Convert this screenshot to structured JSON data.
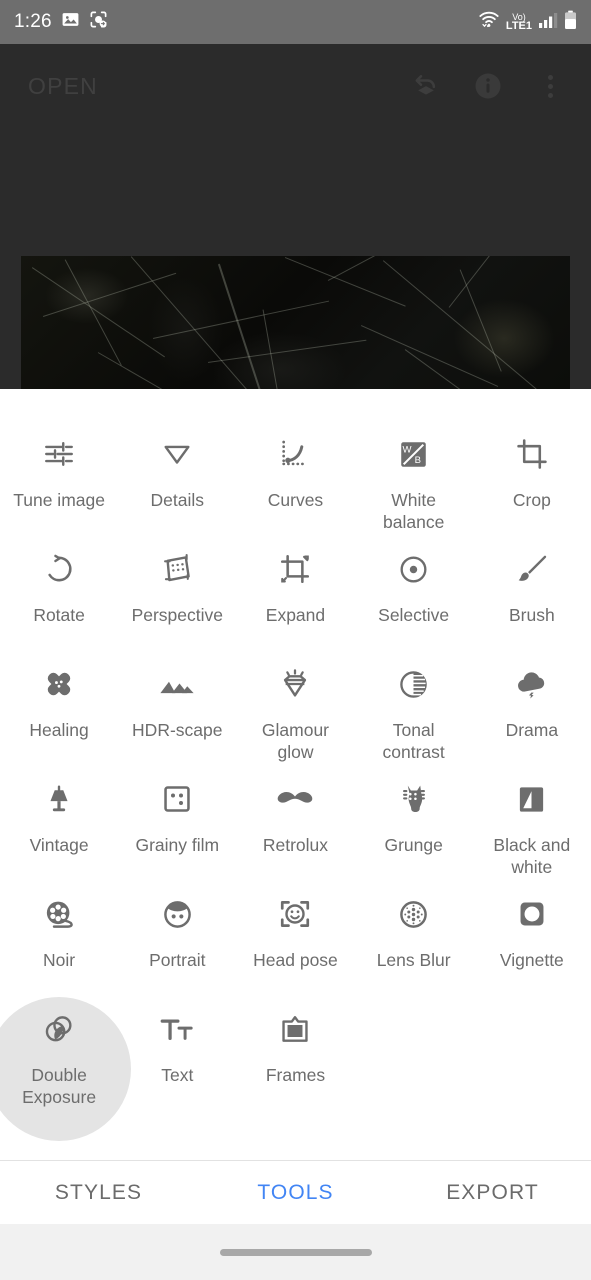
{
  "status_bar": {
    "time": "1:26",
    "left_icons": [
      "image-icon",
      "screenshot-capture-icon"
    ],
    "right_icons": [
      "wifi-icon",
      "volte-icon",
      "signal-icon",
      "battery-icon"
    ],
    "network_label": "Vo)",
    "network_type": "LTE1",
    "background": "#6e6e6e"
  },
  "editor": {
    "open_label": "OPEN",
    "background": "#2b2b2b",
    "actions": [
      {
        "name": "undo-stack-icon",
        "label": "Undo"
      },
      {
        "name": "info-icon",
        "label": "Info"
      },
      {
        "name": "overflow-menu-icon",
        "label": "More options"
      }
    ]
  },
  "tools": {
    "rows": [
      [
        {
          "label": "Tune image",
          "icon": "tune-image-icon"
        },
        {
          "label": "Details",
          "icon": "details-icon"
        },
        {
          "label": "Curves",
          "icon": "curves-icon"
        },
        {
          "label": "White balance",
          "icon": "white-balance-icon"
        },
        {
          "label": "Crop",
          "icon": "crop-icon"
        }
      ],
      [
        {
          "label": "Rotate",
          "icon": "rotate-icon"
        },
        {
          "label": "Perspective",
          "icon": "perspective-icon"
        },
        {
          "label": "Expand",
          "icon": "expand-icon"
        },
        {
          "label": "Selective",
          "icon": "selective-icon"
        },
        {
          "label": "Brush",
          "icon": "brush-icon"
        }
      ],
      [
        {
          "label": "Healing",
          "icon": "healing-icon"
        },
        {
          "label": "HDR-scape",
          "icon": "hdr-scape-icon"
        },
        {
          "label": "Glamour glow",
          "icon": "glamour-glow-icon"
        },
        {
          "label": "Tonal contrast",
          "icon": "tonal-contrast-icon"
        },
        {
          "label": "Drama",
          "icon": "drama-icon"
        }
      ],
      [
        {
          "label": "Vintage",
          "icon": "vintage-icon"
        },
        {
          "label": "Grainy film",
          "icon": "grainy-film-icon"
        },
        {
          "label": "Retrolux",
          "icon": "retrolux-icon"
        },
        {
          "label": "Grunge",
          "icon": "grunge-icon"
        },
        {
          "label": "Black and white",
          "icon": "black-and-white-icon"
        }
      ],
      [
        {
          "label": "Noir",
          "icon": "noir-icon"
        },
        {
          "label": "Portrait",
          "icon": "portrait-icon"
        },
        {
          "label": "Head pose",
          "icon": "head-pose-icon"
        },
        {
          "label": "Lens Blur",
          "icon": "lens-blur-icon"
        },
        {
          "label": "Vignette",
          "icon": "vignette-icon"
        }
      ],
      [
        {
          "label": "Double Exposure",
          "icon": "double-exposure-icon",
          "pressed": true
        },
        {
          "label": "Text",
          "icon": "text-icon"
        },
        {
          "label": "Frames",
          "icon": "frames-icon"
        }
      ]
    ],
    "icon_color": "#6d6d6d",
    "label_color": "#6d6d6d",
    "ripple_color": "#e4e4e4"
  },
  "tabs": [
    {
      "label": "STYLES",
      "active": false
    },
    {
      "label": "TOOLS",
      "active": true
    },
    {
      "label": "EXPORT",
      "active": false
    }
  ],
  "accent_color": "#4285f4",
  "nav_bar": {
    "handle": "home-gesture-pill",
    "background": "#f1f1f1"
  }
}
